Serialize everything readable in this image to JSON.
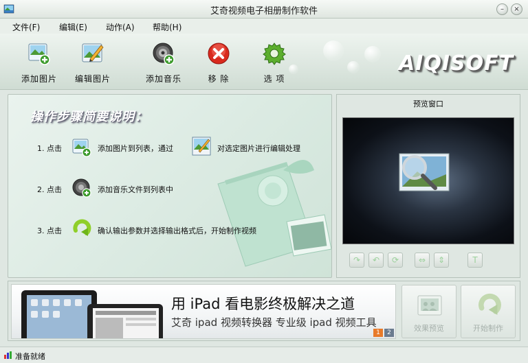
{
  "window": {
    "title": "艾奇视频电子相册制作软件"
  },
  "menu": [
    {
      "label": "文件(F)"
    },
    {
      "label": "编辑(E)"
    },
    {
      "label": "动作(A)"
    },
    {
      "label": "帮助(H)"
    }
  ],
  "toolbar": {
    "add_image": "添加图片",
    "edit_image": "编辑图片",
    "add_music": "添加音乐",
    "remove": "移 除",
    "options": "选 项",
    "logo": "AIQISOFT"
  },
  "steps": {
    "title": "操作步骤简要说明：",
    "step1_prefix": "1. 点击",
    "step1_mid": "添加图片到列表，通过",
    "step1_suffix": "对选定图片进行编辑处理",
    "step2_prefix": "2. 点击",
    "step2_text": "添加音乐文件到列表中",
    "step3_prefix": "3. 点击",
    "step3_text": "确认输出参数并选择输出格式后，开始制作视频"
  },
  "preview": {
    "title": "预览窗口"
  },
  "banner": {
    "line1": "用 iPad 看电影终极解决之道",
    "line2": "艾奇 ipad 视频转换器  专业级 ipad 视频工具",
    "page1": "1",
    "page2": "2"
  },
  "actions": {
    "preview_effect": "效果预览",
    "start_make": "开始制作"
  },
  "status": {
    "text": "准备就绪"
  },
  "colors": {
    "accent_green": "#5cae2e",
    "remove_red": "#d92a1e"
  }
}
